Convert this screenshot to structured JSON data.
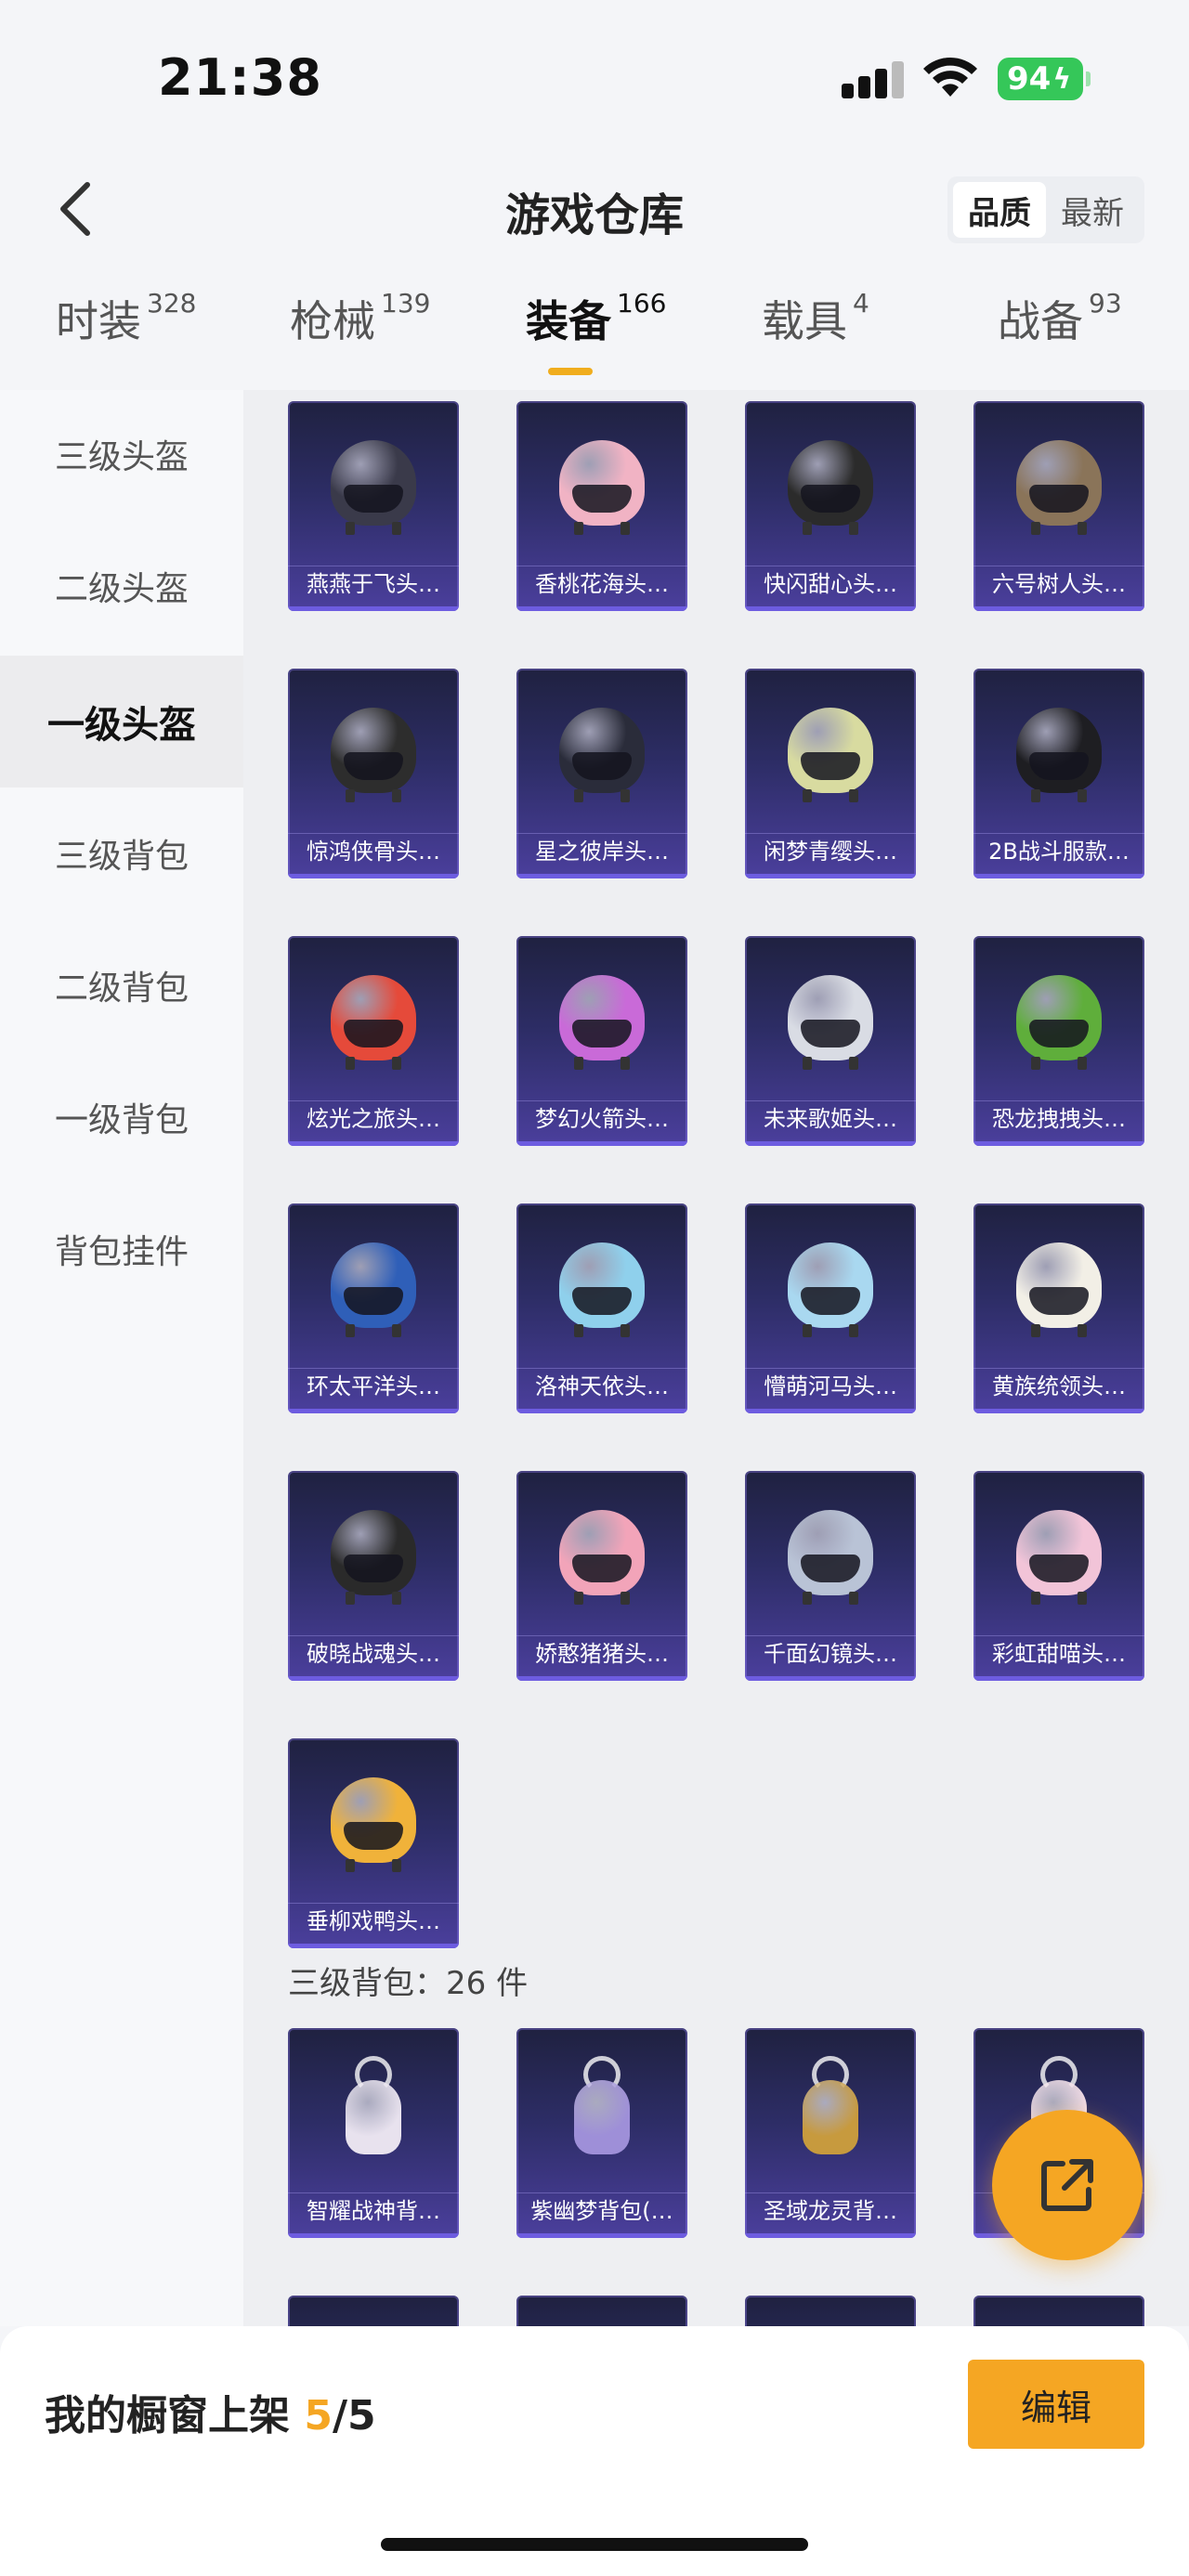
{
  "status_bar": {
    "time": "21:38",
    "battery": "94"
  },
  "header": {
    "title": "游戏仓库",
    "sort_options": [
      "品质",
      "最新"
    ],
    "sort_selected": "品质"
  },
  "tabs": [
    {
      "label": "时装",
      "count": "328"
    },
    {
      "label": "枪械",
      "count": "139"
    },
    {
      "label": "装备",
      "count": "166",
      "active": true
    },
    {
      "label": "载具",
      "count": "4"
    },
    {
      "label": "战备",
      "count": "93"
    }
  ],
  "sidebar": {
    "items": [
      "三级头盔",
      "二级头盔",
      "一级头盔",
      "三级背包",
      "二级背包",
      "一级背包",
      "背包挂件"
    ],
    "active": "一级头盔"
  },
  "helmets": [
    {
      "label": "燕燕于飞头…",
      "color": "#3a3a4a"
    },
    {
      "label": "香桃花海头…",
      "color": "#f1b3c4"
    },
    {
      "label": "快闪甜心头…",
      "color": "#2b2b2b"
    },
    {
      "label": "六号树人头…",
      "color": "#8a7459"
    },
    {
      "label": "惊鸿侠骨头…",
      "color": "#2d2d2d"
    },
    {
      "label": "星之彼岸头…",
      "color": "#2a2c3a"
    },
    {
      "label": "闲梦青缨头…",
      "color": "#d8dba0"
    },
    {
      "label": "2B战斗服款…",
      "color": "#1e1e22"
    },
    {
      "label": "炫光之旅头…",
      "color": "#e54a3a"
    },
    {
      "label": "梦幻火箭头…",
      "color": "#c96ad8"
    },
    {
      "label": "未来歌姬头…",
      "color": "#d9dce4"
    },
    {
      "label": "恐龙拽拽头…",
      "color": "#5fae3b"
    },
    {
      "label": "环太平洋头…",
      "color": "#2f5fb8"
    },
    {
      "label": "洛神天依头…",
      "color": "#8fd0ec"
    },
    {
      "label": "懵萌河马头…",
      "color": "#a9d8f0"
    },
    {
      "label": "黄族统领头…",
      "color": "#f2efe6"
    },
    {
      "label": "破晓战魂头…",
      "color": "#2a2a2a"
    },
    {
      "label": "娇憨猪猪头…",
      "color": "#f2a4b9"
    },
    {
      "label": "千面幻镜头…",
      "color": "#b9c3d6"
    },
    {
      "label": "彩虹甜喵头…",
      "color": "#f2c4d8"
    },
    {
      "label": "垂柳戏鸭头…",
      "color": "#f0b23a"
    }
  ],
  "backpack_section": {
    "label": "三级背包",
    "count_text": "：26 件"
  },
  "backpacks": [
    {
      "label": "智耀战神背…",
      "color": "#e8e2ee"
    },
    {
      "label": "紫幽梦背包(…",
      "color": "#9e8fd8"
    },
    {
      "label": "圣域龙灵背…",
      "color": "#c79a3e"
    },
    {
      "label": "",
      "color": "#f2dce6"
    }
  ],
  "bottom_bar": {
    "text": "我的橱窗上架 ",
    "current": "5",
    "total": "/5",
    "edit_label": "编辑"
  }
}
